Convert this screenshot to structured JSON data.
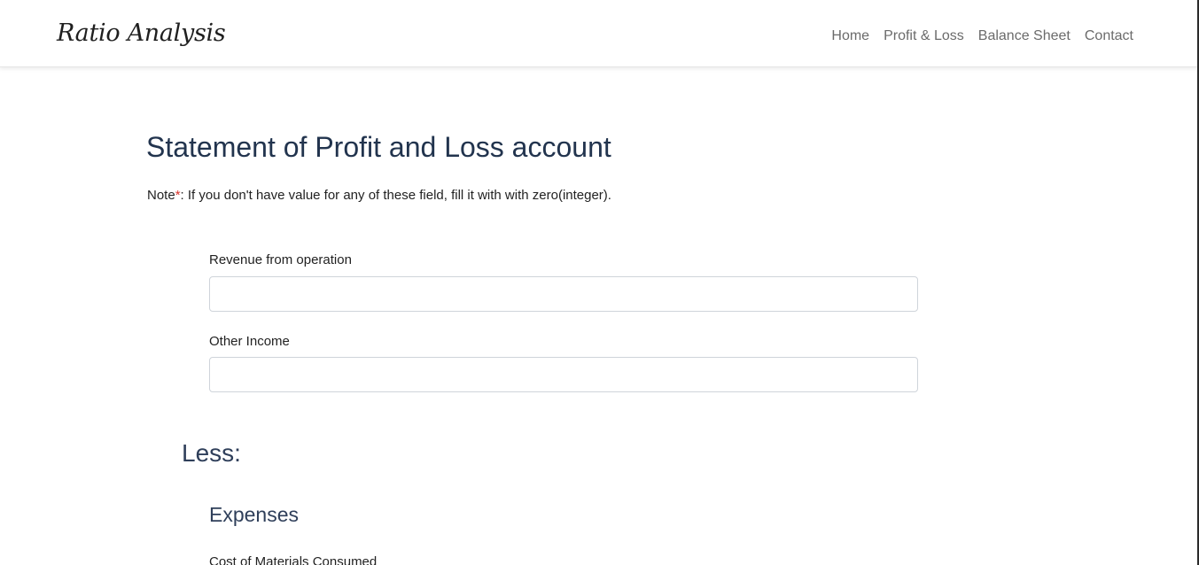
{
  "navbar": {
    "brand": "Ratio Analysis",
    "links": [
      "Home",
      "Profit & Loss",
      "Balance Sheet",
      "Contact"
    ]
  },
  "main": {
    "title": "Statement of Profit and Loss account",
    "note": {
      "prefix": "Note",
      "star": "*",
      "text": ": If you don't have value for any of these field, fill it with with zero(integer)."
    },
    "fields": [
      {
        "label": "Revenue from operation",
        "value": "",
        "placeholder": ""
      },
      {
        "label": "Other Income",
        "value": "",
        "placeholder": ""
      }
    ],
    "less_heading": "Less:",
    "expenses_heading": "Expenses",
    "next_field_label": "Cost of Materials Consumed"
  }
}
